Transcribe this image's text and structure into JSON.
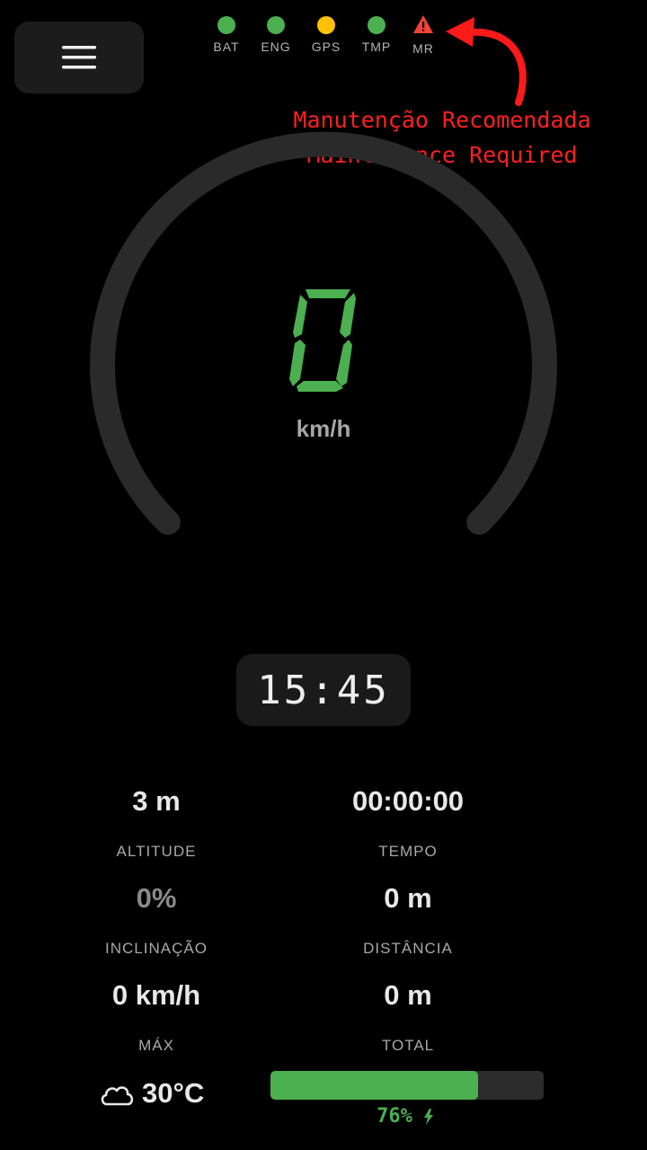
{
  "status_indicators": [
    {
      "label": "BAT",
      "state": "ok",
      "color": "#4caf50"
    },
    {
      "label": "ENG",
      "state": "ok",
      "color": "#4caf50"
    },
    {
      "label": "GPS",
      "state": "warning",
      "color": "#ffc107"
    },
    {
      "label": "TMP",
      "state": "ok",
      "color": "#4caf50"
    },
    {
      "label": "MR",
      "state": "alert",
      "color": "#f44336",
      "icon": "warning-triangle-icon"
    }
  ],
  "annotation": {
    "line1": "Manutenção Recomendada",
    "line2": "Maintenance Required",
    "color": "#ff2020"
  },
  "speedometer": {
    "speed": 0,
    "unit": "km/h",
    "digit_color": "#4caf50",
    "arc_color": "#2a2a2a"
  },
  "clock": {
    "time": "15:45"
  },
  "stats": [
    {
      "value": "3 m",
      "label": "ALTITUDE"
    },
    {
      "value": "00:00:00",
      "label": "TEMPO"
    },
    {
      "value": "0%",
      "label": "INCLINAÇÃO"
    },
    {
      "value": "0 m",
      "label": "DISTÂNCIA"
    },
    {
      "value": "0 km/h",
      "label": "MÁX"
    },
    {
      "value": "0 m",
      "label": "TOTAL"
    }
  ],
  "weather": {
    "temperature": "30°C",
    "icon": "cloud-icon"
  },
  "battery": {
    "percent_text": "76%",
    "level": 0.76,
    "charging": true,
    "icon": "lightning-bolt-icon",
    "color": "#4caf50"
  },
  "menu": {
    "icon": "hamburger-menu-icon"
  }
}
